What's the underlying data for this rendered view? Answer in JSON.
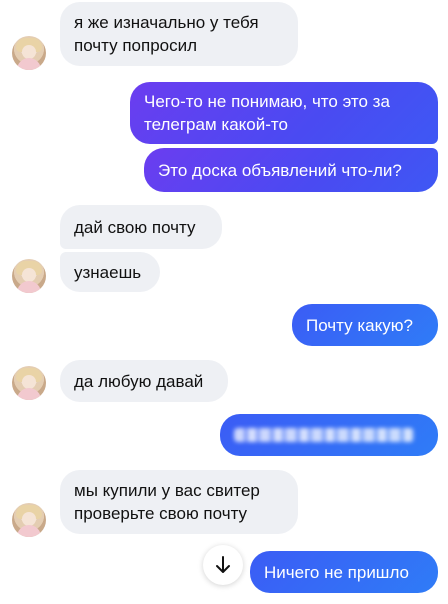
{
  "messages": {
    "m1": {
      "line1": "я же изначально у тебя",
      "line2": "почту попросил"
    },
    "m2": {
      "line1": "Чего-то не понимаю, что это за",
      "line2": "телеграм какой-то"
    },
    "m3": {
      "text": "Это доска объявлений что-ли?"
    },
    "m4": {
      "text": "дай свою почту"
    },
    "m5": {
      "text": "узнаешь"
    },
    "m6": {
      "text": "Почту какую?"
    },
    "m7": {
      "text": "да любую давай"
    },
    "m9": {
      "line1": "мы купили у вас свитер",
      "line2": "проверьте свою почту"
    },
    "m10": {
      "text": "Ничего не пришло"
    }
  },
  "icons": {
    "scroll_down": "arrow-down-icon",
    "avatar": "avatar"
  },
  "colors": {
    "incoming_bg": "#eef0f4",
    "outgoing_gradient_start": "#6b3df0",
    "outgoing_gradient_end": "#3e58f4",
    "outgoing_blue": "#2f7cf7"
  }
}
